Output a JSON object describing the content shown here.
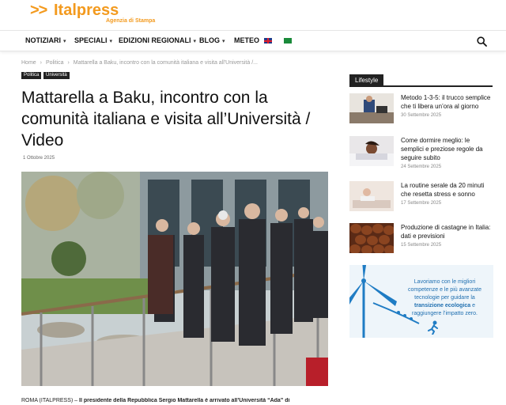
{
  "brand": {
    "arrows": ">>",
    "name": "Italpress",
    "tagline": "Agenzia di Stampa",
    "color": "#f39a1e"
  },
  "nav": {
    "items": [
      {
        "label": "NOTIZIARI"
      },
      {
        "label": "SPECIALI"
      },
      {
        "label": "EDIZIONI REGIONALI"
      },
      {
        "label": "BLOG"
      },
      {
        "label": "METEO"
      }
    ],
    "caret": "▾",
    "search_icon": "search-icon"
  },
  "breadcrumb": {
    "home": "Home",
    "sep": "›",
    "section": "Politica",
    "current": "Mattarella a Baku, incontro con la comunità italiana e visita all'Università /..."
  },
  "tags": [
    "Politica",
    "Università"
  ],
  "article": {
    "title": "Mattarella a Baku, incontro con la comunità italiana e visita all’Università / Video",
    "date": "1 Ottobre 2025",
    "lead_prefix": "ROMA (ITALPRESS) – ",
    "lead_bold": "Il presidente della Repubblica Sergio Mattarella è arrivato all’Università “Ada” di"
  },
  "sidebar": {
    "heading": "Lifestyle",
    "items": [
      {
        "title": "Metodo 1-3-5: il trucco semplice che ti libera un’ora al giorno",
        "date": "30 Settembre 2025"
      },
      {
        "title": "Come dormire meglio: le semplici e preziose regole da seguire subito",
        "date": "24 Settembre 2025"
      },
      {
        "title": "La routine serale da 20 minuti che resetta stress e sonno",
        "date": "17 Settembre 2025"
      },
      {
        "title": "Produzione di castagne in Italia: dati e previsioni",
        "date": "15 Settembre 2025"
      }
    ],
    "ad": {
      "text_start": "Lavoriamo con le migliori competenze e le più avanzate tecnologie per guidare la ",
      "text_bold": "transizione ecologica",
      "text_end": " e raggiungere l’impatto zero."
    }
  }
}
